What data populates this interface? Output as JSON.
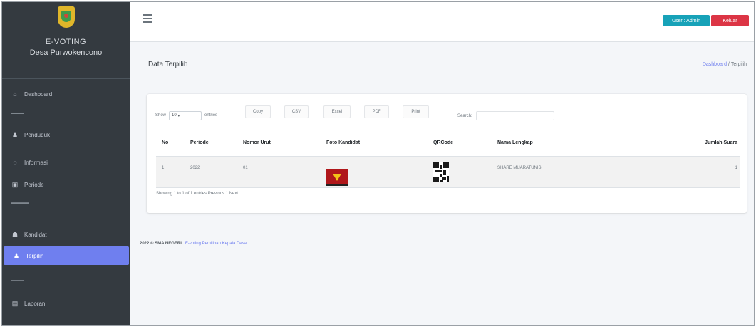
{
  "brand": {
    "title": "E-VOTING",
    "subtitle": "Desa Purwokencono"
  },
  "sidebar": {
    "items": [
      {
        "label": "Dashboard",
        "icon": "home-icon"
      },
      {
        "label": "Penduduk",
        "icon": "user-icon"
      },
      {
        "label": "Informasi",
        "icon": "info-icon"
      },
      {
        "label": "Periode",
        "icon": "calendar-icon"
      },
      {
        "label": "Kandidat",
        "icon": "users-icon"
      },
      {
        "label": "Terpilih",
        "icon": "user-check-icon",
        "active": true
      },
      {
        "label": "Laporan",
        "icon": "chart-icon"
      }
    ]
  },
  "topbar": {
    "user_label": "User : Admin",
    "logout_label": "Keluar"
  },
  "page": {
    "title": "Data Terpilih",
    "breadcrumb": {
      "home": "Dashboard",
      "separator": "/",
      "current": "Terpilih"
    }
  },
  "table_controls": {
    "show_label": "Show",
    "page_size": "10",
    "entries_label": "entries",
    "export": [
      "Copy",
      "CSV",
      "Excel",
      "PDF",
      "Print"
    ],
    "search_label": "Search:"
  },
  "table": {
    "headers": [
      "No",
      "Periode",
      "Nomor Urut",
      "Foto Kandidat",
      "QRCode",
      "Nama Lengkap",
      "Jumlah Suara"
    ],
    "rows": [
      {
        "no": "1",
        "periode": "2022",
        "nomor_urut": "01",
        "nama": "SHARE MUARATUNIS",
        "jumlah": "1"
      }
    ],
    "info": "Showing 1 to 1 of 1 entries Previous 1 Next"
  },
  "footer": {
    "copyright": "2022 © SMA NEGERI",
    "credit": "E-voting Pemilihan Kepala Desa"
  },
  "colors": {
    "sidebar": "#343a40",
    "active": "#6f7fef",
    "user_button": "#17a2b8",
    "logout_button": "#dc3545"
  }
}
